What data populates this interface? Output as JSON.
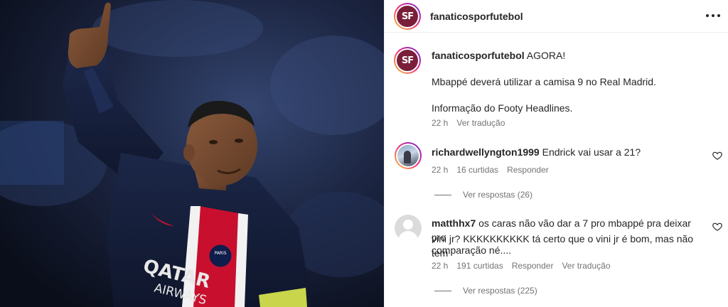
{
  "post": {
    "username": "fanaticosporfutebol",
    "logo_text": "SF",
    "logo_subtext": "FANATICOS POR FUTEBOL",
    "brand_color": "#7a1f3a"
  },
  "photo": {
    "shirt_sponsor": "QATAR",
    "shirt_sponsor_2": "AIRWAYS",
    "crest_text": "PARIS"
  },
  "caption": {
    "username": "fanaticosporfutebol",
    "line1": "AGORA!",
    "line2": "Mbappé deverá utilizar a camisa 9 no Real Madrid.",
    "line3": "Informação do Footy Headlines.",
    "time": "22 h",
    "translate": "Ver tradução"
  },
  "comments": [
    {
      "username": "richardwellyngton1999",
      "text": "Endrick vai usar a 21?",
      "time": "22 h",
      "likes": "16 curtidas",
      "reply": "Responder",
      "view_replies": "Ver respostas (26)"
    },
    {
      "username": "matthhx7",
      "text_line1": "os caras não vão dar a 7 pro mbappé pra deixar pro",
      "text_line2": "vini jr? KKKKKKKKKK tá certo que o vini jr é bom, mas não tem",
      "text_line3": "comparação né....",
      "time": "22 h",
      "likes": "191 curtidas",
      "reply": "Responder",
      "translate": "Ver tradução",
      "view_replies": "Ver respostas (225)"
    }
  ]
}
